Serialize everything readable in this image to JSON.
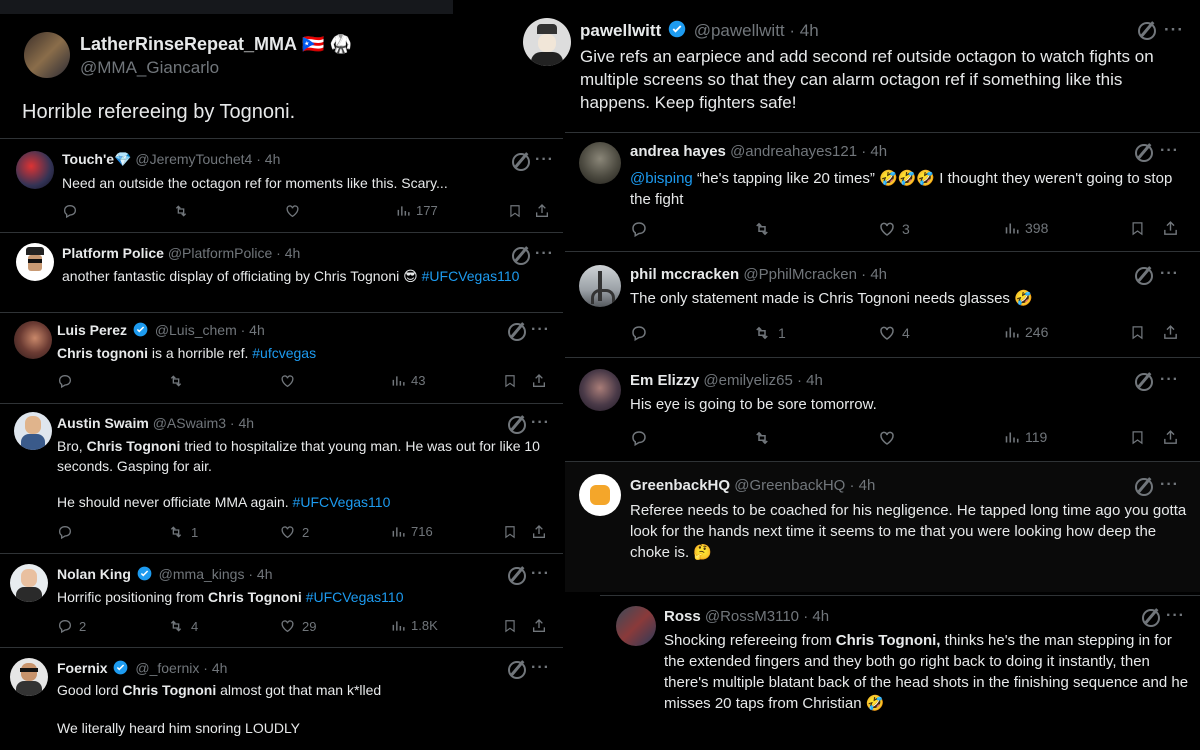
{
  "colors": {
    "bg": "#000000",
    "text": "#e7e9ea",
    "meta": "#71767b",
    "link": "#1d9bf0",
    "divider": "#2f3336",
    "verified": "#1d9bf0"
  },
  "left": {
    "main": {
      "name": "LatherRinseRepeat_MMA",
      "flags": "🇵🇷 🥋",
      "handle": "@MMA_Giancarlo",
      "text": "Horrible refereeing by Tognoni."
    },
    "replies": [
      {
        "name": "Touch'e",
        "badge": "💎",
        "handle": "@JeremyTouchet4",
        "time": "· 4h",
        "text": "Need an outside the octagon ref for moments like this. Scary...",
        "views": "177",
        "replies": "",
        "retweets": "",
        "likes": ""
      },
      {
        "name": "Platform Police",
        "handle": "@PlatformPolice",
        "time": "· 4h",
        "text": "another fantastic display of officiating by Chris Tognoni 😎",
        "hashtag": "#UFCVegas110"
      },
      {
        "name": "Luis Perez",
        "handle": "@Luis_chem",
        "time": "· 4h",
        "bold": "Chris tognoni",
        "text": "is a horrible ref.",
        "hashtag": "#ufcvegas",
        "views": "43",
        "replies": "",
        "retweets": "",
        "likes": ""
      },
      {
        "name": "Austin Swaim",
        "handle": "@ASwaim3",
        "time": "· 4h",
        "pre": "Bro,",
        "bold": "Chris Tognoni",
        "text": "tried to hospitalize that young man. He was out for like 10 seconds. Gasping for air.",
        "text2": "He should never officiate MMA again.",
        "hashtag": "#UFCVegas110",
        "views": "716",
        "replies": "",
        "retweets": "1",
        "likes": "2"
      },
      {
        "name": "Nolan King",
        "handle": "@mma_kings",
        "time": "· 4h",
        "pre": "Horrific positioning from",
        "bold": "Chris Tognoni",
        "hashtag": "#UFCVegas110",
        "views": "1.8K",
        "replies": "2",
        "retweets": "4",
        "likes": "29"
      },
      {
        "name": "Foernix",
        "handle": "@_foernix",
        "time": "· 4h",
        "pre": "Good lord",
        "bold": "Chris Tognoni",
        "text": "almost got that man k*lled",
        "text2": "We literally heard him snoring LOUDLY"
      }
    ]
  },
  "right": {
    "main": {
      "name": "pawellwitt",
      "handle": "@pawellwitt",
      "time": "· 4h",
      "text": "Give refs an earpiece and add second ref outside octagon to watch fights on multiple screens so that they can alarm octagon ref if something like this happens. Keep fighters safe!"
    },
    "replies": [
      {
        "name": "andrea hayes",
        "handle": "@andreahayes121",
        "time": "· 4h",
        "mention": "@bisping",
        "text": "“he's tapping like 20 times”",
        "emoji": "🤣🤣🤣",
        "text2": "I thought they weren't going to stop the fight",
        "views": "398",
        "replies": "",
        "retweets": "",
        "likes": "3"
      },
      {
        "name": "phil mccracken",
        "handle": "@PphilMcracken",
        "time": "· 4h",
        "text": "The only statement made is Chris Tognoni needs glasses",
        "emoji": "🤣",
        "views": "246",
        "replies": "",
        "retweets": "1",
        "likes": "4"
      },
      {
        "name": "Em Elizzy",
        "handle": "@emilyeliz65",
        "time": "· 4h",
        "text": "His eye is going to be sore tomorrow.",
        "views": "119",
        "replies": "",
        "retweets": "",
        "likes": ""
      },
      {
        "name": "GreenbackHQ",
        "handle": "@GreenbackHQ",
        "time": "· 4h",
        "text": "Referee needs to be coached for his negligence. He tapped long time ago you gotta look for the hands next time it seems to me that you were looking how deep the choke is.",
        "emoji": "🤔"
      },
      {
        "name": "Ross",
        "handle": "@RossM3110",
        "time": "· 4h",
        "pre": "Shocking refereeing from",
        "bold": "Chris Tognoni,",
        "text": "thinks he's the man stepping in for the extended fingers and they both go right back to doing it instantly, then there's multiple blatant back of the head shots in the finishing sequence and he misses 20 taps from Christian",
        "emoji": "🤣"
      }
    ]
  }
}
